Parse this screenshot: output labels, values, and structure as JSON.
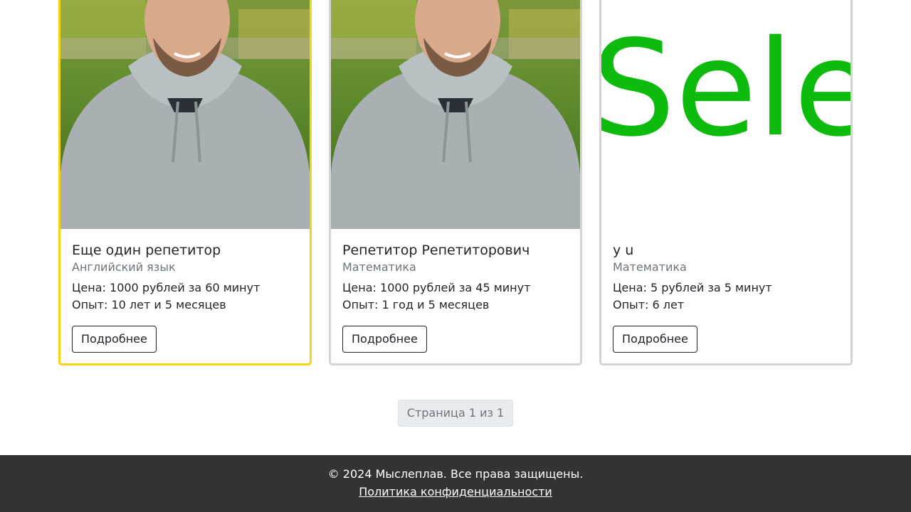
{
  "tutors": [
    {
      "name": "Еще один репетитор",
      "subject": "Английский язык",
      "price": "Цена: 1000 рублей за 60 минут",
      "experience": "Опыт: 10 лет и 5 месяцев",
      "button": "Подробнее"
    },
    {
      "name": "Репетитор Репетиторович",
      "subject": "Математика",
      "price": "Цена: 1000 рублей за 45 минут",
      "experience": "Опыт: 1 год и 5 месяцев",
      "button": "Подробнее"
    },
    {
      "name": "y u",
      "subject": "Математика",
      "price": "Цена: 5 рублей за 5 минут",
      "experience": "Опыт: 6 лет",
      "button": "Подробнее",
      "image_text": "Selen"
    }
  ],
  "pagination": {
    "label": "Страница 1 из 1"
  },
  "footer": {
    "copyright": "© 2024 Мыслеплав. Все права защищены.",
    "privacy_link": "Политика конфиденциальности"
  },
  "colors": {
    "featured_border": "#f5d414",
    "card_border": "#d4d4d4",
    "footer_bg": "#333333",
    "logo_green": "#0dbb0d"
  }
}
